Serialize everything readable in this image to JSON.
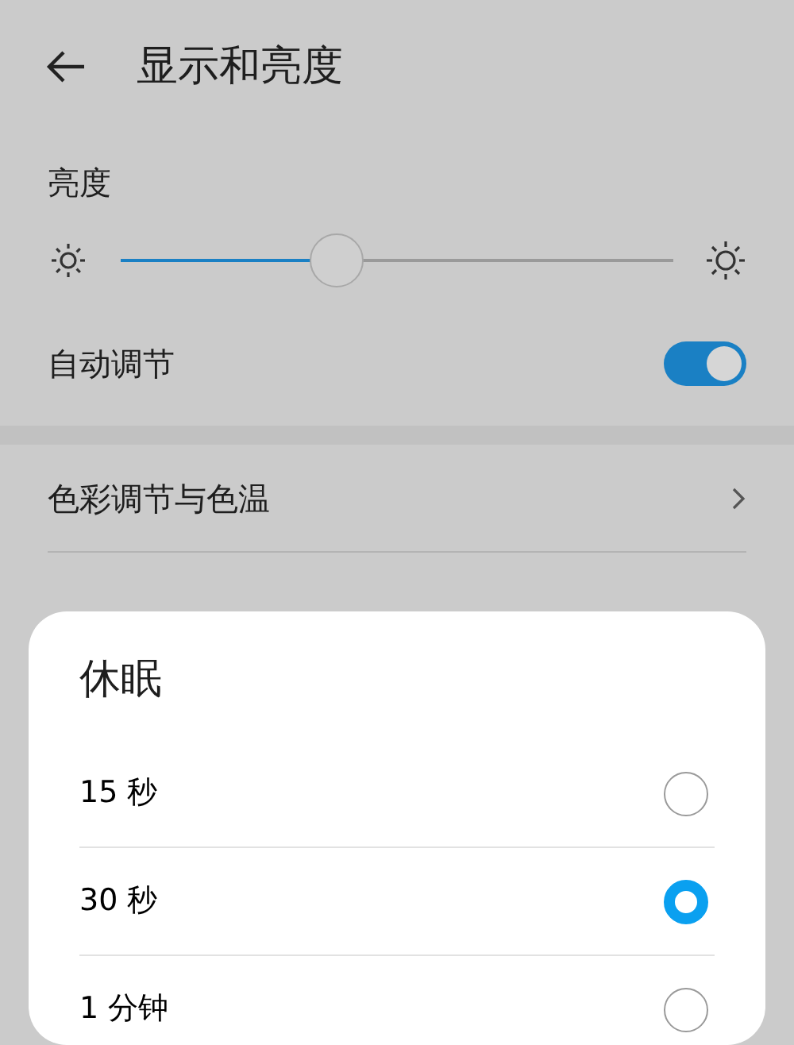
{
  "header": {
    "title": "显示和亮度"
  },
  "brightness": {
    "label": "亮度",
    "level": 0.39
  },
  "auto_adjust": {
    "label": "自动调节",
    "on": true
  },
  "settings": [
    {
      "label": "色彩调节与色温"
    }
  ],
  "dialog": {
    "title": "休眠",
    "options": [
      {
        "label": "15 秒",
        "selected": false
      },
      {
        "label": "30 秒",
        "selected": true
      },
      {
        "label": "1 分钟",
        "selected": false
      }
    ]
  }
}
